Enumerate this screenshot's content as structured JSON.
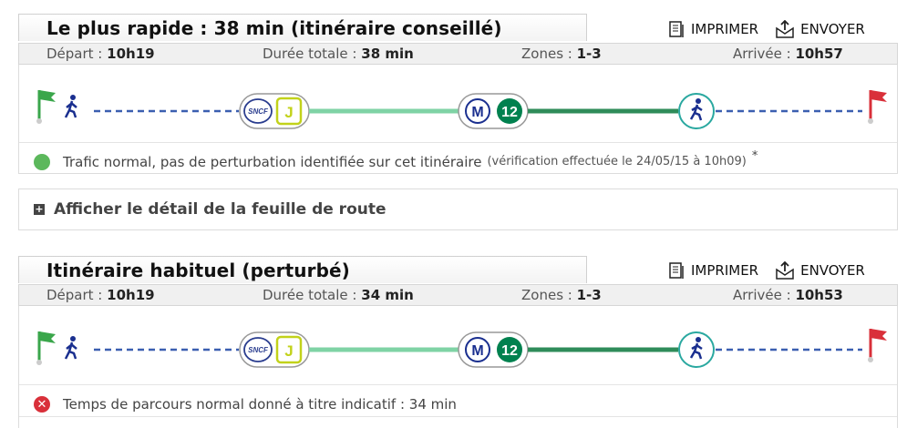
{
  "common": {
    "print_label": "IMPRIMER",
    "send_label": "ENVOYER",
    "depart_label": "Départ :",
    "duree_label": "Durée totale :",
    "zones_label": "Zones :",
    "arrivee_label": "Arrivée :",
    "sncf_text": "SNCF",
    "line_j": "J",
    "metro_m": "M",
    "metro_12": "12"
  },
  "routes": [
    {
      "title": "Le plus rapide : 38 min (itinéraire conseillé)",
      "depart": "10h19",
      "duree": "38 min",
      "zones": "1-3",
      "arrivee": "10h57",
      "status": "Trafic normal, pas de perturbation identifiée sur cet itinéraire",
      "status_note": "(vérification effectuée le 24/05/15 à 10h09)",
      "status_mark": "*"
    },
    {
      "title": "Itinéraire habituel (perturbé)",
      "depart": "10h19",
      "duree": "34 min",
      "zones": "1-3",
      "arrivee": "10h53",
      "status": "Temps de parcours normal donné à titre indicatif : 34 min"
    }
  ],
  "detail_toggle": "Afficher le détail de la feuille de route",
  "colors": {
    "flag_start": "#3aa64b",
    "flag_end": "#d9303a",
    "walk_dash": "#3b5fb0",
    "rer_line": "#7fd3a5",
    "metro_line": "#2f8c5a",
    "line_j_color": "#c2d21a",
    "metro_12_color": "#00814f",
    "status_ok": "#5cb85c",
    "status_bad": "#d9303a"
  },
  "icons": [
    "print-icon",
    "send-icon",
    "start-flag-icon",
    "walk-icon",
    "sncf-icon",
    "line-j-icon",
    "metro-icon",
    "line-12-icon",
    "end-flag-icon",
    "plus-icon"
  ]
}
